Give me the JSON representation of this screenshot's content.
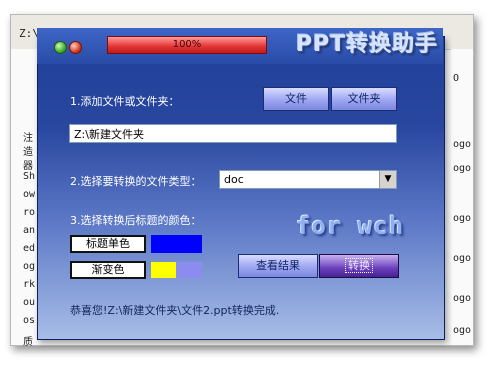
{
  "background": {
    "address": "Z:\\",
    "left_chars": [
      "注",
      "造",
      "器",
      "Sh",
      "ow",
      "ro",
      "an",
      "ed",
      "og",
      "rk",
      "ou",
      "os",
      "质"
    ],
    "right_chars": [
      "O",
      "ogo",
      "ogo",
      "ogo",
      "ogo",
      "ogo",
      "ogo"
    ]
  },
  "titlebar": {
    "progress_text": "100%",
    "progress_value": 1.0,
    "app_title": "PPT转换助手"
  },
  "step1": {
    "label": "1.添加文件或文件夹：",
    "file_button": "文件",
    "folder_button": "文件夹",
    "path_value": "Z:\\新建文件夹"
  },
  "step2": {
    "label": "2.选择要转换的文件类型：",
    "selected_type": "doc",
    "arrow": "▼"
  },
  "step3": {
    "label": "3.选择转换后标题的颜色：",
    "single_color_button": "标题单色",
    "single_color": "#0000ff",
    "gradient_button": "渐变色",
    "gradient_colors": [
      "#ffff00",
      "#8c8cf0"
    ]
  },
  "watermark": "for wch",
  "actions": {
    "view_result": "查看结果",
    "convert": "转换"
  },
  "status_message": "恭喜您!Z:\\新建文件夹\\文件2.ppt转换完成."
}
